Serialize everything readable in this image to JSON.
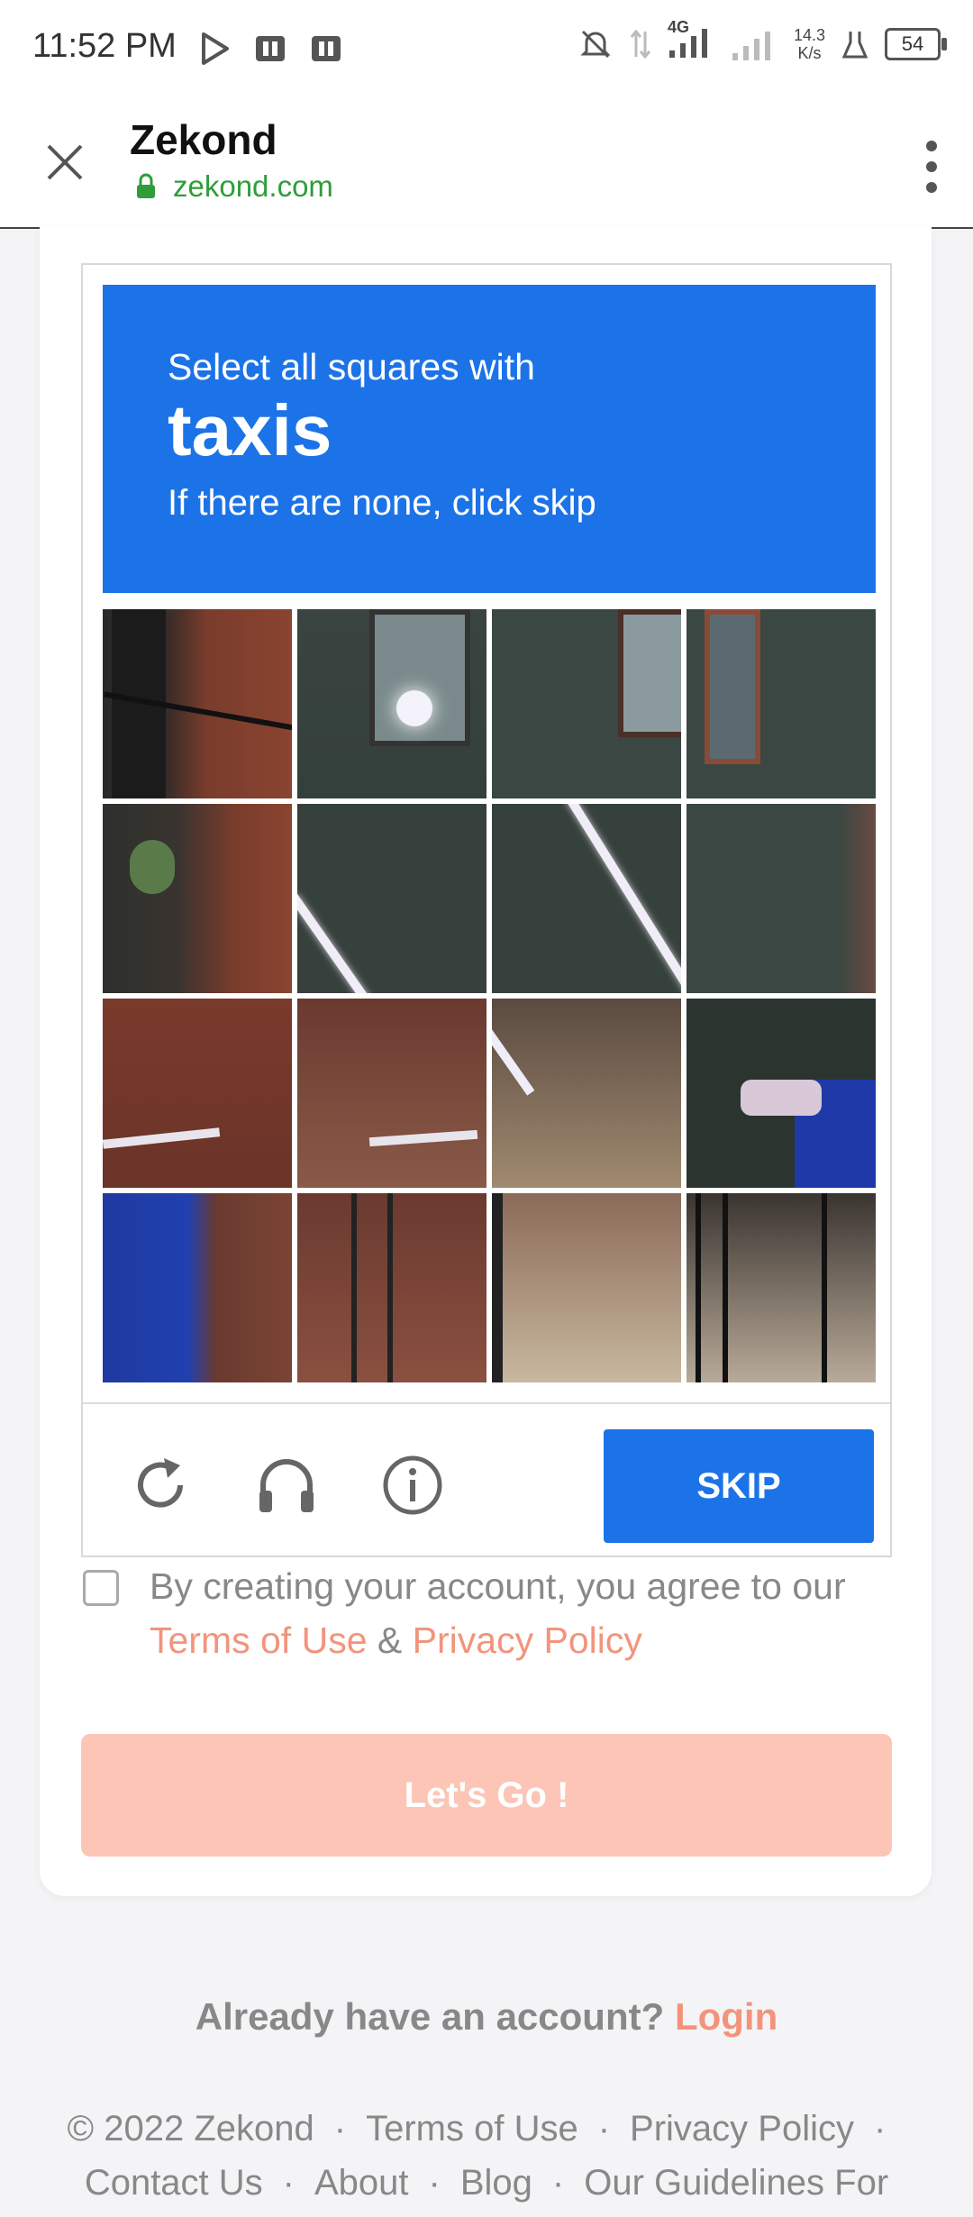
{
  "status": {
    "time": "11:52 PM",
    "network": "4G",
    "speed_value": "14.3",
    "speed_unit": "K/s",
    "battery": "54"
  },
  "browser": {
    "title": "Zekond",
    "url": "zekond.com"
  },
  "captcha": {
    "instruction": "Select all squares with",
    "keyword": "taxis",
    "hint": "If there are none, click skip",
    "skip_label": "SKIP",
    "reload_icon": "reload-icon",
    "audio_icon": "headphones-icon",
    "info_icon": "info-icon",
    "header_color": "#1c73e8"
  },
  "terms": {
    "text": "By creating your account, you agree to our",
    "terms_link": "Terms of Use",
    "amp": "&",
    "privacy_link": "Privacy Policy"
  },
  "cta": {
    "label": "Let's Go !"
  },
  "login_prompt": {
    "text": "Already have an account?",
    "link": "Login"
  },
  "footer": {
    "row1": [
      "© 2022 Zekond",
      "Terms of Use",
      "Privacy Policy"
    ],
    "row2": [
      "Contact Us",
      "About",
      "Blog",
      "Our Guidelines For"
    ],
    "separator": "·"
  },
  "colors": {
    "accent": "#f2947c",
    "button_disabled": "#fcc5b6",
    "link_green": "#2f9d3a"
  }
}
